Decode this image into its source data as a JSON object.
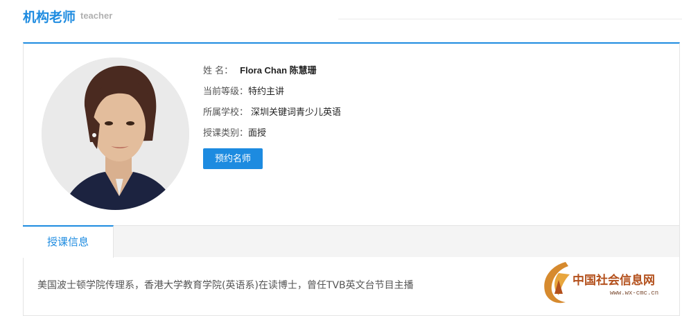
{
  "header": {
    "title": "机构老师",
    "subtitle": "teacher"
  },
  "teacher": {
    "name_label": "姓  名：",
    "name": "Flora Chan 陈慧珊",
    "level_label": "当前等级：",
    "level": "特约主讲",
    "school_label": "所属学校：",
    "school": "深圳关键词青少儿英语",
    "type_label": "授课类别：",
    "type": "面授",
    "book_button": "预约名师"
  },
  "tabs": [
    {
      "label": "授课信息",
      "active": true
    }
  ],
  "description": "美国波士顿学院传理系，香港大学教育学院(英语系)在读博士，曾任TVB英文台节目主播",
  "watermark": {
    "text": "中国社会信息网",
    "url": "www.wx-cmc.cn"
  },
  "colors": {
    "accent": "#1d8be0",
    "tab_bar_bg": "#f4f4f4",
    "watermark": "#b3501c"
  }
}
